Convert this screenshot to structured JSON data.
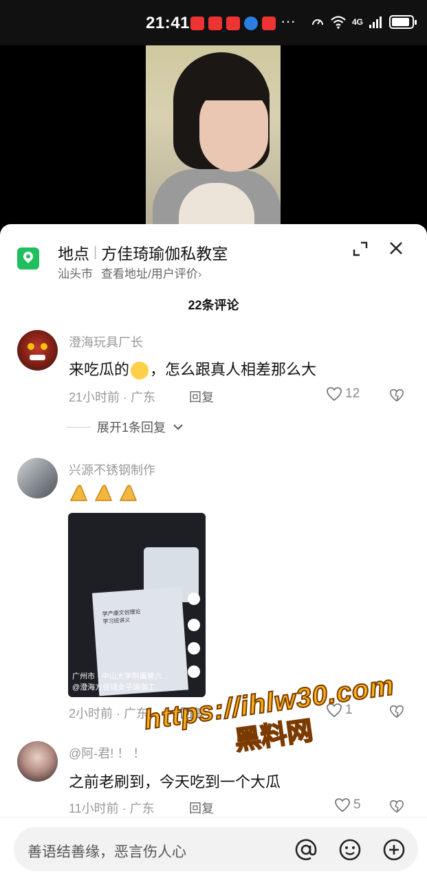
{
  "status_bar": {
    "time": "21:41",
    "more": "···",
    "network": "4G",
    "battery_level": 0.9
  },
  "location": {
    "label": "地点",
    "place_name": "方佳琦瑜伽私教室",
    "city": "汕头市",
    "link": "查看地址/用户评价",
    "chevron": "›"
  },
  "comment_count": "22条评论",
  "comments": [
    {
      "username": "澄海玩具厂长",
      "text_before": "来吃瓜的",
      "emoji": "grinning-sweat-emoji",
      "text_after": "，怎么跟真人相差那么大",
      "time": "21小时前 · 广东",
      "reply": "回复",
      "likes": "12",
      "expand_label": "展开1条回复"
    },
    {
      "username": "兴源不锈钢制作",
      "emoji": "thumbs-up-x3-emoji",
      "image_overlay_location": "广州市 · 中山大学附属第六...",
      "image_overlay_user": "@澄海方佳琦女子瑜伽工...",
      "image_paper_title": "学产康文创理论",
      "image_paper_sub": "学习班讲义",
      "time": "2小时前 · 广东",
      "reply": "回复",
      "likes": "1"
    },
    {
      "username": "@阿-君! ！ ！",
      "text": "之前老刷到，今天吃到一个大瓜",
      "time": "11小时前 · 广东",
      "reply": "回复",
      "likes": "5"
    }
  ],
  "watermark": {
    "url": "https://ihlw30.com",
    "name": "黑料网"
  },
  "input": {
    "placeholder": "善语结善缘，恶言伤人心"
  },
  "colors": {
    "location_pin": "#1fbf5f",
    "watermark": "#f7b21a"
  }
}
